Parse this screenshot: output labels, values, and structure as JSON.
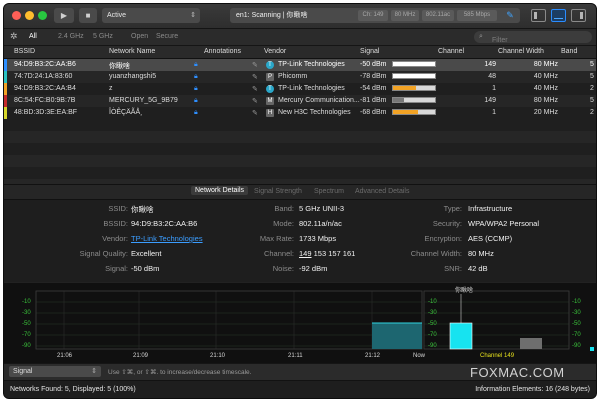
{
  "toolbar": {
    "mode_value": "Active",
    "status_text": "en1: Scanning | 你瞅啥",
    "pills": [
      "Ch: 149",
      "80 MHz",
      "802.11ac",
      "585 Mbps"
    ]
  },
  "filterbar": {
    "tabs": [
      "All",
      "2.4 GHz",
      "5 GHz",
      "Open",
      "Secure"
    ],
    "filter_placeholder": "Filter"
  },
  "table": {
    "columns": [
      "BSSID",
      "Network Name",
      "Annotations",
      "Vendor",
      "Signal",
      "Channel",
      "Channel Width",
      "Band"
    ],
    "rows": [
      {
        "bssid": "94:D9:B3:2C:AA:B6",
        "name": "你瞅啥",
        "vendor": "TP-Link Technologies",
        "vendor_icon": "TP",
        "signal": "-50 dBm",
        "signal_level": 0.88,
        "signal_color": "#f0f0f0",
        "channel": "149",
        "width": "80 MHz",
        "band": "5",
        "color": "#2f8fff",
        "selected": true
      },
      {
        "bssid": "74:7D:24:1A:83:60",
        "name": "yuanzhangshi5",
        "vendor": "Phicomm",
        "vendor_icon": "P",
        "signal": "-78 dBm",
        "signal_level": 0.15,
        "signal_color": "#f0f0f0",
        "channel": "48",
        "width": "40 MHz",
        "band": "5",
        "color": "#29c2c2",
        "selected": false
      },
      {
        "bssid": "94:D9:B3:2C:AA:B4",
        "name": "z",
        "vendor": "TP-Link Technologies",
        "vendor_icon": "TP",
        "signal": "-54 dBm",
        "signal_level": 0.55,
        "signal_color": "#f2a325",
        "channel": "1",
        "width": "40 MHz",
        "band": "2",
        "color": "#f2a325",
        "selected": false
      },
      {
        "bssid": "8C:54:FC:B0:9B:7B",
        "name": "MERCURY_5G_9B79",
        "vendor": "Mercury Communication...",
        "vendor_icon": "M",
        "signal": "-81 dBm",
        "signal_level": 0.25,
        "signal_color": "#777777",
        "channel": "149",
        "width": "80 MHz",
        "band": "5",
        "color": "#c42a2a",
        "selected": false
      },
      {
        "bssid": "48:BD:3D:3E:EA:BF",
        "name": "ÎÒÊÇÄÃÅ¸",
        "vendor": "New H3C Technologies",
        "vendor_icon": "H",
        "signal": "-68 dBm",
        "signal_level": 0.6,
        "signal_color": "#f2a325",
        "channel": "1",
        "width": "20 MHz",
        "band": "2",
        "color": "#d6d62a",
        "selected": false
      }
    ]
  },
  "details": {
    "tabs": [
      "Network Details",
      "Signal Strength",
      "Spectrum",
      "Advanced Details"
    ],
    "col1": [
      {
        "label": "SSID:",
        "value": "你瞅啥"
      },
      {
        "label": "BSSID:",
        "value": "94:D9:B3:2C:AA:B6"
      },
      {
        "label": "Vendor:",
        "value": "TP-Link Technologies"
      },
      {
        "label": "Signal Quality:",
        "value": "Excellent"
      },
      {
        "label": "Signal:",
        "value": "-50 dBm"
      }
    ],
    "col2": [
      {
        "label": "Band:",
        "value": "5 GHz UNII-3"
      },
      {
        "label": "Mode:",
        "value": "802.11a/n/ac"
      },
      {
        "label": "Max Rate:",
        "value": "1733 Mbps"
      },
      {
        "label": "Channel:",
        "value_main": "149",
        "value_rest": " 153 157 161"
      },
      {
        "label": "Noise:",
        "value": "-92 dBm"
      }
    ],
    "col3": [
      {
        "label": "Type:",
        "value": "Infrastructure"
      },
      {
        "label": "Security:",
        "value": "WPA/WPA2 Personal"
      },
      {
        "label": "Encryption:",
        "value": "AES (CCMP)"
      },
      {
        "label": "Channel Width:",
        "value": "80 MHz"
      },
      {
        "label": "SNR:",
        "value": "42 dB"
      }
    ]
  },
  "graph": {
    "y_ticks": [
      "-10",
      "-30",
      "-50",
      "-70",
      "-90"
    ],
    "x_ticks": [
      "21:06",
      "21:09",
      "21:10",
      "21:11",
      "21:12",
      "Now"
    ],
    "right_label": "你瞅啥",
    "channel_caption": "Channel 149"
  },
  "bottombar": {
    "metric": "Signal",
    "hint": "Use ⇧⌘, or ⇧⌘. to increase/decrease timescale.",
    "watermark": "FOXMAC.COM"
  },
  "statusbar": {
    "left": "Networks Found: 5, Displayed: 5 (100%)",
    "right": "Information Elements: 16 (248 bytes)"
  }
}
